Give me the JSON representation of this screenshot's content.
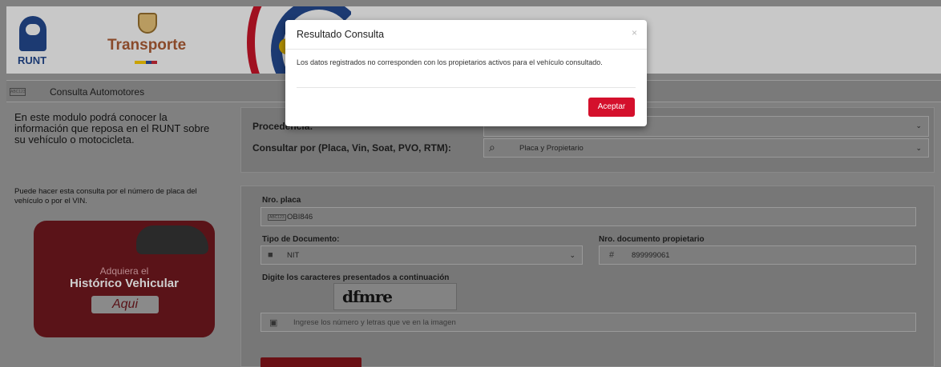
{
  "header": {
    "runt_label": "RUNT",
    "ministry_label": "Transporte"
  },
  "subbar": {
    "badge": "ABC123",
    "title": "Consulta Automotores"
  },
  "left": {
    "intro": "En este modulo podrá conocer la información que reposa en el RUNT sobre su vehículo o motocicleta.",
    "intro2": "Puede hacer esta consulta por el número de placa del vehículo o por el VIN.",
    "promo": {
      "line1": "Adquiera el",
      "line2": "Histórico Vehicular",
      "button": "Aqui"
    }
  },
  "form_top": {
    "procedencia_label": "Procedencia:",
    "consultar_label": "Consultar por (Placa, Vin, Soat, PVO, RTM):",
    "consultar_value": "Placa y Propietario"
  },
  "form": {
    "placa_label": "Nro. placa",
    "placa_badge": "ABC123",
    "placa_value": "OBI846",
    "tipo_doc_label": "Tipo de Documento:",
    "tipo_doc_value": "NIT",
    "nro_doc_label": "Nro. documento propietario",
    "nro_doc_prefix": "#",
    "nro_doc_value": "899999061",
    "captcha_label": "Digite los caracteres presentados a continuación",
    "captcha_text": "dfmre",
    "captcha_placeholder": "Ingrese los número y letras que ve en la imagen"
  },
  "modal": {
    "title": "Resultado Consulta",
    "close": "×",
    "body": "Los datos registrados no corresponden con los propietarios activos para el vehículo consultado.",
    "ok_button": "Aceptar"
  },
  "colors": {
    "accent": "#d4102c",
    "overlay": "#808080"
  },
  "icons": [
    "search-car-icon",
    "user-icon",
    "lock-icon",
    "close-icon",
    "chevron-down-icon"
  ]
}
